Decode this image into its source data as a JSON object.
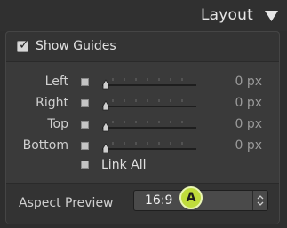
{
  "header": {
    "title": "Layout"
  },
  "guides": {
    "show_label": "Show Guides",
    "show_checked": true
  },
  "rows": [
    {
      "label": "Left",
      "value": "0 px"
    },
    {
      "label": "Right",
      "value": "0 px"
    },
    {
      "label": "Top",
      "value": "0 px"
    },
    {
      "label": "Bottom",
      "value": "0 px"
    }
  ],
  "link_all": {
    "label": "Link All"
  },
  "aspect": {
    "label": "Aspect Preview",
    "value": "16:9"
  },
  "callout": {
    "letter": "A",
    "color": "#bfdc3c"
  }
}
